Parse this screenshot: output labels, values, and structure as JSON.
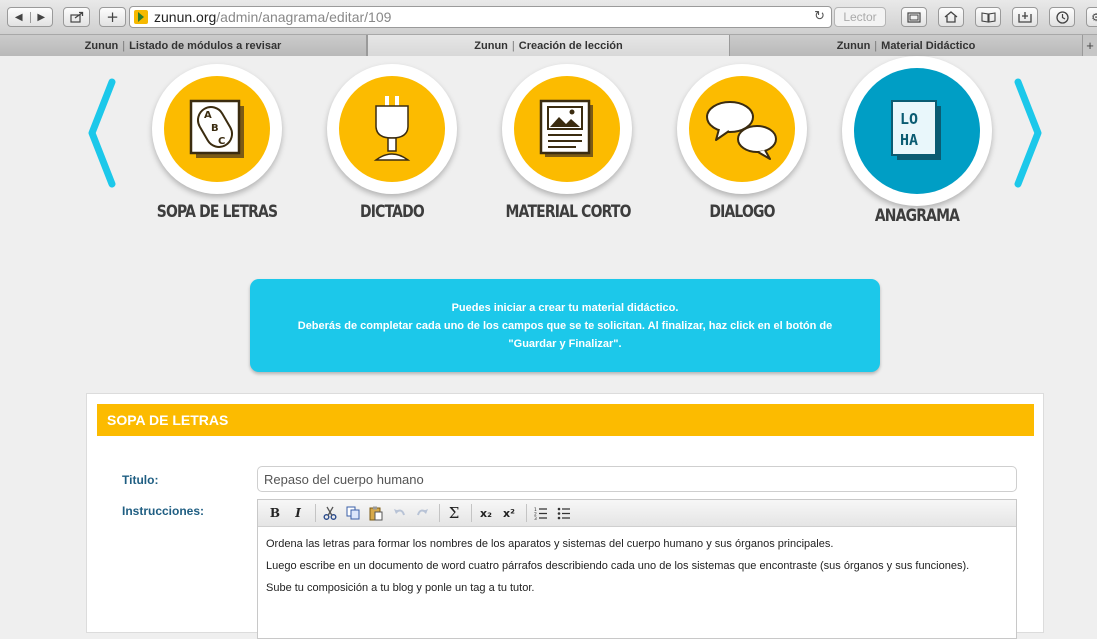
{
  "browser": {
    "url_host": "zunun.org",
    "url_path": "/admin/anagrama/editar/109",
    "reader_label": "Lector",
    "tabs": [
      {
        "site": "Zunun",
        "title": "Listado de módulos a revisar"
      },
      {
        "site": "Zunun",
        "title": "Creación de lección"
      },
      {
        "site": "Zunun",
        "title": "Material Didáctico"
      }
    ],
    "new_tab": "+"
  },
  "modules": [
    {
      "label": "SOPA DE LETRAS",
      "icon": "abc-letters-icon"
    },
    {
      "label": "DICTADO",
      "icon": "microphone-icon"
    },
    {
      "label": "MATERIAL CORTO",
      "icon": "picture-document-icon"
    },
    {
      "label": "DIALOGO",
      "icon": "speech-bubbles-icon"
    },
    {
      "label": "ANAGRAMA",
      "icon": "letter-cards-icon",
      "active": true
    }
  ],
  "anagram_letters": [
    "LO",
    "HA"
  ],
  "abc_letters": [
    "A",
    "B",
    "C"
  ],
  "info": {
    "line1": "Puedes iniciar a crear tu material didáctico.",
    "line2": "Deberás de completar cada uno de los campos que se te solicitan. Al finalizar, haz click en el botón de",
    "line3": "\"Guardar y Finalizar\"."
  },
  "form": {
    "section_title": "SOPA DE LETRAS",
    "title_label": "Titulo:",
    "title_value": "Repaso del cuerpo humano",
    "instructions_label": "Instrucciones:",
    "toolbar": [
      "B",
      "I",
      "cut",
      "copy",
      "paste",
      "undo",
      "redo",
      "Σ",
      "x₂",
      "x²",
      "ordered-list",
      "unordered-list"
    ],
    "instructions_lines": [
      "Ordena las letras para formar los nombres de los aparatos y sistemas del cuerpo humano y sus órganos principales.",
      "Luego escribe en un documento de word cuatro párrafos describiendo cada uno de los sistemas que encontraste (sus órganos y sus funciones).",
      "Sube tu composición a tu blog y ponle un tag a tu tutor."
    ]
  },
  "colors": {
    "yellow": "#fcbb00",
    "blue": "#009ec5",
    "cyan": "#1cc8ea",
    "label_blue": "#1f5e82"
  }
}
